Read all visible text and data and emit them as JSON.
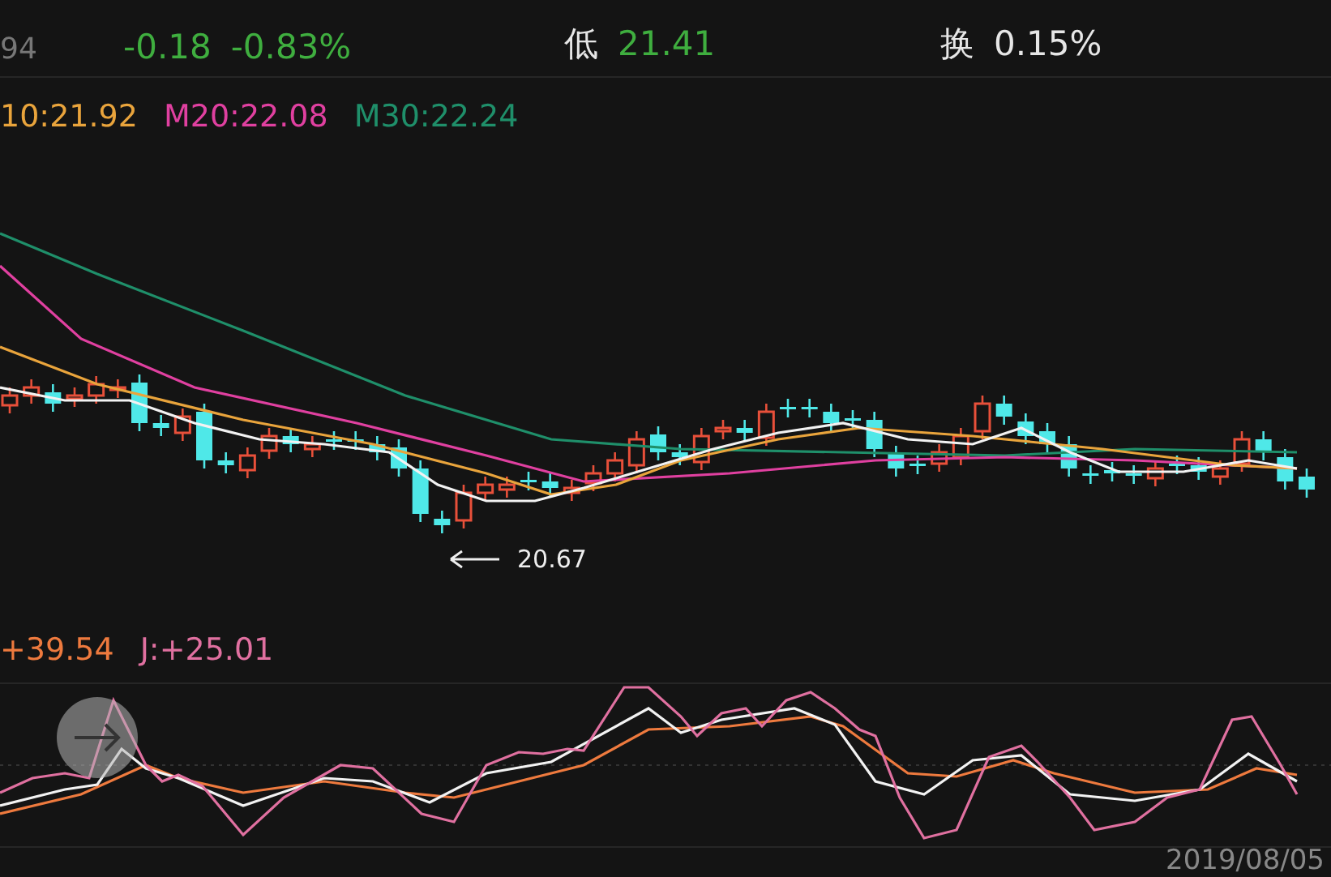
{
  "quote": {
    "prev_fragment": "94",
    "change": "-0.18",
    "change_pct": "-0.83%",
    "color": "#3fae3f",
    "stats": [
      {
        "label": "低",
        "value": "21.41",
        "color": "#3fae3f"
      },
      {
        "label": "换",
        "value": "0.15%",
        "color": "#e6e6e6"
      }
    ]
  },
  "ma_legend": [
    {
      "text": "10:21.92",
      "color": "#e9a43c"
    },
    {
      "text": "M20:22.08",
      "color": "#e040a0"
    },
    {
      "text": "M30:22.24",
      "color": "#1f8f6a"
    }
  ],
  "price_chart": {
    "low_marker": "20.67"
  },
  "kdj_legend": [
    {
      "text": "+39.54",
      "color": "#ee7a3e"
    },
    {
      "text": "J:+25.01",
      "color": "#e070a0"
    }
  ],
  "date": "2019/08/05"
}
